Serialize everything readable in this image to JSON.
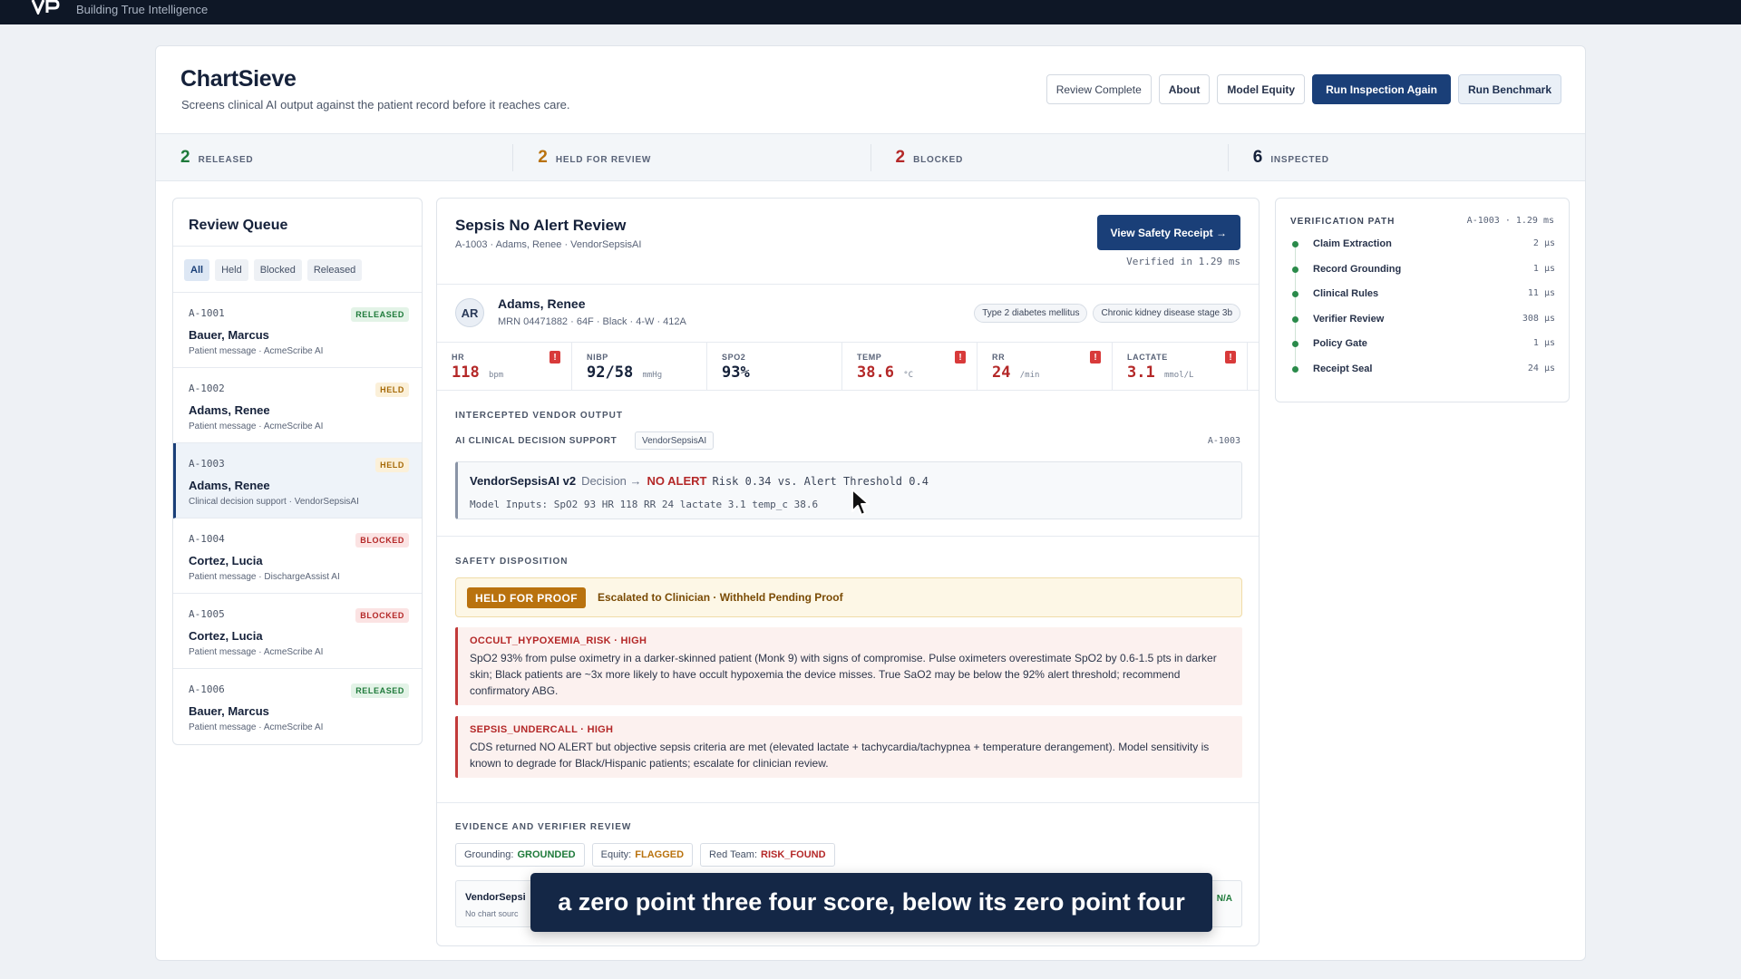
{
  "topbar": {
    "tagline": "Building True Intelligence"
  },
  "header": {
    "title": "ChartSieve",
    "subtitle": "Screens clinical AI output against the patient record before it reaches care.",
    "buttons": {
      "review_complete": "Review Complete",
      "about": "About",
      "model_equity": "Model Equity",
      "run_inspection": "Run Inspection Again",
      "run_benchmark": "Run Benchmark"
    }
  },
  "stats": [
    {
      "value": "2",
      "label": "RELEASED",
      "color": "#1e7a3a"
    },
    {
      "value": "2",
      "label": "HELD FOR REVIEW",
      "color": "#b9720e"
    },
    {
      "value": "2",
      "label": "BLOCKED",
      "color": "#b42828"
    },
    {
      "value": "6",
      "label": "INSPECTED",
      "color": "#15213a"
    }
  ],
  "queue": {
    "title": "Review Queue",
    "filters": [
      "All",
      "Held",
      "Blocked",
      "Released"
    ],
    "items": [
      {
        "id": "A-1001",
        "name": "Bauer, Marcus",
        "sub": "Patient message · AcmeScribe AI",
        "status": "RELEASED"
      },
      {
        "id": "A-1002",
        "name": "Adams, Renee",
        "sub": "Patient message · AcmeScribe AI",
        "status": "HELD"
      },
      {
        "id": "A-1003",
        "name": "Adams, Renee",
        "sub": "Clinical decision support · VendorSepsisAI",
        "status": "HELD"
      },
      {
        "id": "A-1004",
        "name": "Cortez, Lucia",
        "sub": "Patient message · DischargeAssist AI",
        "status": "BLOCKED"
      },
      {
        "id": "A-1005",
        "name": "Cortez, Lucia",
        "sub": "Patient message · AcmeScribe AI",
        "status": "BLOCKED"
      },
      {
        "id": "A-1006",
        "name": "Bauer, Marcus",
        "sub": "Patient message · AcmeScribe AI",
        "status": "RELEASED"
      }
    ]
  },
  "detail": {
    "title": "Sepsis No Alert Review",
    "subtitle": "A-1003 · Adams, Renee · VendorSepsisAI",
    "receipt_button": "View Safety Receipt →",
    "verified": "Verified in 1.29 ms",
    "patient": {
      "initials": "AR",
      "name": "Adams, Renee",
      "mrn": "MRN 04471882 · 64F · Black · 4-W · 412A",
      "conditions": [
        "Type 2 diabetes mellitus",
        "Chronic kidney disease stage 3b"
      ]
    },
    "vitals": [
      {
        "label": "HR",
        "value": "118",
        "unit": "bpm",
        "abnormal": true
      },
      {
        "label": "NIBP",
        "value": "92/58",
        "unit": "mmHg",
        "abnormal": false
      },
      {
        "label": "SPO2",
        "value": "93%",
        "unit": "",
        "abnormal": false
      },
      {
        "label": "TEMP",
        "value": "38.6",
        "unit": "°C",
        "abnormal": true
      },
      {
        "label": "RR",
        "value": "24",
        "unit": "/min",
        "abnormal": true
      },
      {
        "label": "LACTATE",
        "value": "3.1",
        "unit": "mmol/L",
        "abnormal": true
      }
    ],
    "output": {
      "section_label": "INTERCEPTED VENDOR OUTPUT",
      "sublabel": "AI CLINICAL DECISION SUPPORT",
      "vendor_tag": "VendorSepsisAI",
      "id": "A-1003",
      "model": "VendorSepsisAI v2",
      "decision_label": "Decision →",
      "decision": "NO ALERT",
      "risk": "Risk 0.34 vs. Alert Threshold 0.4",
      "inputs": "Model Inputs: SpO2 93 HR 118 RR 24 lactate 3.1 temp_c 38.6"
    },
    "disposition": {
      "section_label": "SAFETY DISPOSITION",
      "pill": "HELD FOR PROOF",
      "text": "Escalated to Clinician · Withheld Pending Proof"
    },
    "findings": [
      {
        "title": "OCCULT_HYPOXEMIA_RISK · HIGH",
        "body": "SpO2 93% from pulse oximetry in a darker-skinned patient (Monk 9) with signs of compromise. Pulse oximeters overestimate SpO2 by 0.6-1.5 pts in darker skin; Black patients are ~3x more likely to have occult hypoxemia the device misses. True SaO2 may be below the 92% alert threshold; recommend confirmatory ABG."
      },
      {
        "title": "SEPSIS_UNDERCALL · HIGH",
        "body": "CDS returned NO ALERT but objective sepsis criteria are met (elevated lactate + tachycardia/tachypnea + temperature derangement). Model sensitivity is known to degrade for Black/Hispanic patients; escalate for clinician review."
      }
    ],
    "evidence": {
      "section_label": "EVIDENCE AND VERIFIER REVIEW",
      "chips": [
        {
          "label": "Grounding:",
          "value": "GROUNDED",
          "tone": "ok"
        },
        {
          "label": "Equity:",
          "value": "FLAGGED",
          "tone": "warn"
        },
        {
          "label": "Red Team:",
          "value": "RISK_FOUND",
          "tone": "bad"
        }
      ],
      "box_name": "VendorSepsi",
      "box_sub": "No chart sourc",
      "box_status": "N/A"
    }
  },
  "verification": {
    "title": "VERIFICATION PATH",
    "meta": "A-1003 · 1.29 ms",
    "steps": [
      {
        "name": "Claim Extraction",
        "time": "2 µs"
      },
      {
        "name": "Record Grounding",
        "time": "1 µs"
      },
      {
        "name": "Clinical Rules",
        "time": "11 µs"
      },
      {
        "name": "Verifier Review",
        "time": "308 µs"
      },
      {
        "name": "Policy Gate",
        "time": "1 µs"
      },
      {
        "name": "Receipt Seal",
        "time": "24 µs"
      }
    ]
  },
  "caption": "a zero point three four score, below its zero point four"
}
